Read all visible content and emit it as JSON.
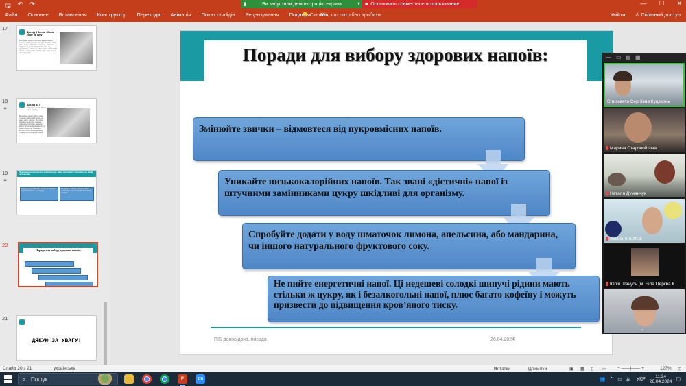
{
  "titlebar": {
    "demo_text": "Ви запустили демонстрацію екрана",
    "stop_text": "Остановить совместное использование",
    "qa_icons": [
      "save-icon",
      "undo-icon",
      "redo-icon"
    ],
    "window_controls": [
      "—",
      "☐",
      "✕"
    ]
  },
  "ribbon": {
    "tabs": [
      "Файл",
      "Основне",
      "Вставлення",
      "Конструктор",
      "Переходи",
      "Анімація",
      "Показ слайдів",
      "Рецензування",
      "Подання",
      "Міх"
    ],
    "search_hint": "Скажіть, що потрібно зробити...",
    "sign_in": "Увійти",
    "share": "Спільний доступ"
  },
  "thumbnails": {
    "numbers": [
      "17",
      "18",
      "19",
      "20",
      "21"
    ],
    "slide17": {
      "title": "Дослід 3 Вплив «Coca-cola» на іржу",
      "body": "Висновок: Цвях в розчині з іржею. Іржа в розчині зникла, іржею все розчинилося. Тому ніхто може розчиняти поверхню, оскільки піддається дії фосфорної кислоти. Це ортофосфорна кислота Висновок: цей напій є таким ж шкідливим напоєм, ніж з ним чи ні з ним не кидати."
    },
    "slide18": {
      "title": "Дослід № 4",
      "sub": "Впливати вплив «Пепсі-кола» на живу тканину",
      "body": "Висновок: Напій руйнує живу тканину. Шкідливий вплив на нашу шкіру і кістки. Він також впливає на органи людини, руйнуючи її будову, завдяки вмісту ортофосфорної кислоти. Навіть на кістки. Висновок: Вплив «Пепсі-кола» на живу тканину досить небезпечний."
    },
    "slide19": {
      "title": "Порівнюючи наш проєкт, я прийшла до таких висновків і з'ясувала, що напій «Coca-cola»",
      "left": "Порушує здоровий вплив напою на організм, шкідливий вплив, це оксидант.",
      "right": "Попередьте вплив в організм напою «Coca-cola», має складний вплив вікову кількість."
    },
    "slide20": {
      "title": "Поради для вибору здорових напоїв:"
    },
    "slide21": {
      "title": "ДЯКУЮ ЗА УВАГУ!"
    }
  },
  "slide": {
    "title": "Поради для вибору здорових напоїв:",
    "tips": [
      "Змінюйте звички – відмовтеся від пукровмісних напоїв.",
      "Уникайте низькокалорійних напоїв. Так звані «дієтичні» напої із штучними замінниками цукру шкідливі для організму.",
      "Спробуйте додати у воду шматочок лимона, апельсина, або мандарина, чи іншого натурального фруктового соку.",
      "Не пийте енергетичні напої. Ці недешеві солодкі шипучі рідини мають стільки ж цукру, як і безалкогольні напої, плюс багато кофеїну і можуть призвести до підвищення кров’яного тиску."
    ],
    "footer_left": "ПІБ доповідача, посада",
    "footer_date": "26.04.2024"
  },
  "zoom": {
    "participants": [
      "Єлизавета Сергіївна Куцеконь",
      "Марина Старовойтова",
      "Наталя Думанчук",
      "Sviatla Struzhak",
      "Юлія Шанусь (м. Біла Церква К...",
      ""
    ],
    "more_label": "···",
    "down_icon": "chevron-down-icon"
  },
  "statusbar": {
    "slide_info": "Слайд 20 з 21",
    "language": "українська",
    "notes": "Нотатки",
    "comments": "Примітки",
    "zoom_level": "127%"
  },
  "taskbar": {
    "search_label": "Пошук",
    "lang": "УКР",
    "time": "11:24",
    "date": "26.04.2024",
    "apps": [
      "file-explorer-icon",
      "chrome-icon",
      "chrome-icon",
      "powerpoint-icon",
      "zoom-icon"
    ]
  }
}
